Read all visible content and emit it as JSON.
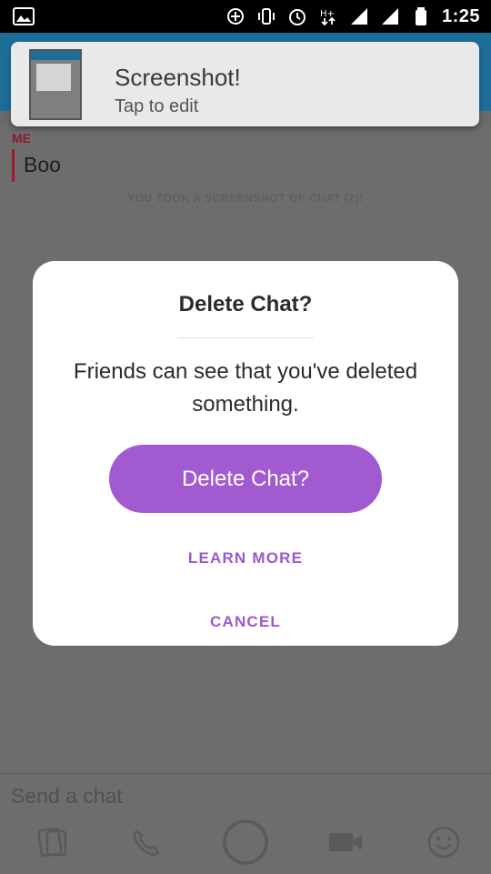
{
  "status_bar": {
    "time": "1:25",
    "icons": [
      "gallery-icon",
      "data-saver-icon",
      "vibrate-icon",
      "alarm-icon",
      "network-hplus-icon",
      "signal-icon-1",
      "signal-icon-2",
      "battery-icon"
    ],
    "network_type": "H+"
  },
  "notification": {
    "title": "Screenshot!",
    "subtitle": "Tap to edit"
  },
  "chat": {
    "sender": "ME",
    "message": "Boo",
    "system_note": "YOU TOOK A SCREENSHOT OF CHAT (2)!"
  },
  "modal": {
    "title": "Delete Chat?",
    "message": "Friends can see that you've deleted something.",
    "primary_button": "Delete Chat?",
    "learn_more": "LEARN MORE",
    "cancel": "CANCEL"
  },
  "composer": {
    "placeholder": "Send a chat"
  },
  "toolbar": {
    "items": [
      "memories-icon",
      "phone-icon",
      "capture-button",
      "video-icon",
      "smiley-icon"
    ]
  },
  "colors": {
    "accent_purple": "#a25ad0",
    "link_purple": "#9b59cc",
    "blue_header": "#1c6e98",
    "sender_red": "#8a1b2a"
  }
}
